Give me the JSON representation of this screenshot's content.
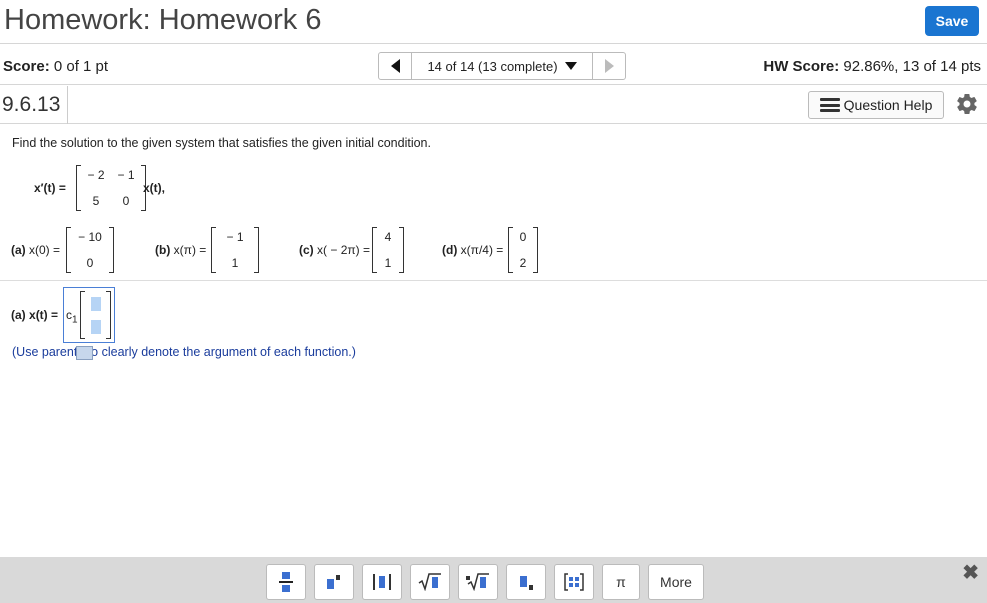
{
  "header": {
    "title": "Homework: Homework 6",
    "save_label": "Save"
  },
  "score_bar": {
    "score_label": "Score:",
    "score_value": "0 of 1 pt",
    "nav_text": "14 of 14 (13 complete)",
    "hw_score_label": "HW Score:",
    "hw_score_value": "92.86%, 13 of 14 pts"
  },
  "question": {
    "number": "9.6.13",
    "help_label": "Question Help"
  },
  "problem": {
    "instruction": "Find the solution to the given system that satisfies the given initial condition.",
    "system_lhs": "x′(t) =",
    "system_matrix": [
      "− 2",
      "− 1",
      "5",
      "0"
    ],
    "system_rhs": "x(t),",
    "conditions": [
      {
        "label_bold": "(a)",
        "label_rest": "x(0) =",
        "vector": [
          "− 10",
          "0"
        ]
      },
      {
        "label_bold": "(b)",
        "label_rest": "x(π) =",
        "vector": [
          "− 1",
          "1"
        ]
      },
      {
        "label_bold": "(c)",
        "label_rest": "x( − 2π) =",
        "vector": [
          "4",
          "1"
        ]
      },
      {
        "label_bold": "(d)",
        "label_rest": "x(π/4) =",
        "vector": [
          "0",
          "2"
        ]
      }
    ]
  },
  "answer": {
    "label_bold": "(a)",
    "label_rest": "x(t) =",
    "coef": "c",
    "coef_sub": "1",
    "hint_before": "(Use parenthe",
    "hint_after": "to clearly denote the argument of each function.)"
  },
  "toolbar": {
    "pi_label": "π",
    "more_label": "More",
    "close_label": "✖"
  },
  "colors": {
    "save_bg": "#1a75d1",
    "toolbar_bg": "#d9d9d9",
    "input_highlight": "#b6d4f5"
  }
}
